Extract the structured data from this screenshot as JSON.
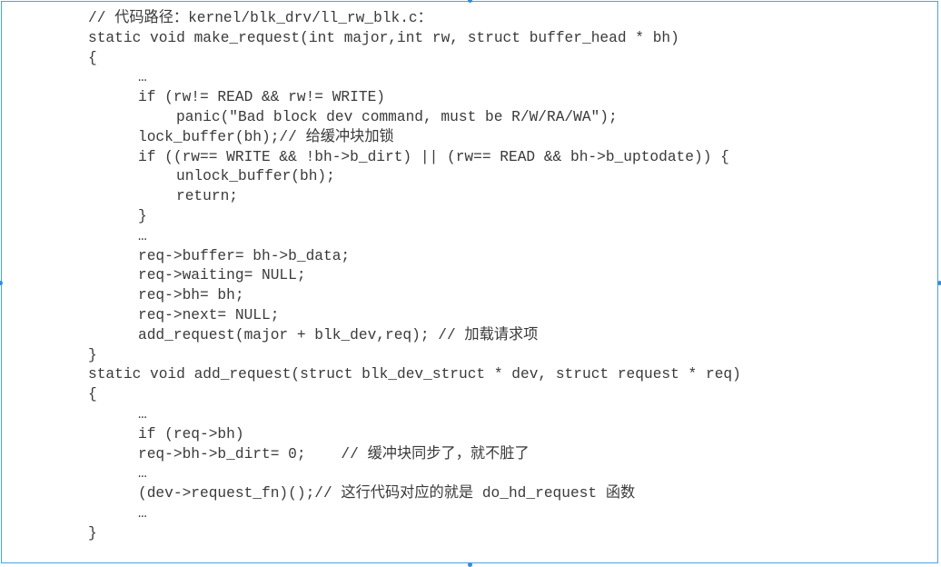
{
  "code_lines": [
    {
      "indent": 0,
      "text": "// 代码路径：kernel/blk_drv/ll_rw_blk.c："
    },
    {
      "indent": 0,
      "text": "static void make_request(int major,int rw, struct buffer_head * bh)"
    },
    {
      "indent": 0,
      "text": "{"
    },
    {
      "indent": 1,
      "text": "…"
    },
    {
      "indent": 1,
      "text": "if (rw!= READ && rw!= WRITE)"
    },
    {
      "indent": 2,
      "text": "panic(\"Bad block dev command, must be R/W/RA/WA\");"
    },
    {
      "indent": 1,
      "text": "lock_buffer(bh);// 给缓冲块加锁"
    },
    {
      "indent": 1,
      "text": "if ((rw== WRITE && !bh->b_dirt) || (rw== READ && bh->b_uptodate)) {"
    },
    {
      "indent": 2,
      "text": "unlock_buffer(bh);"
    },
    {
      "indent": 2,
      "text": "return;"
    },
    {
      "indent": 1,
      "text": "}"
    },
    {
      "indent": 1,
      "text": "…"
    },
    {
      "indent": 1,
      "text": "req->buffer= bh->b_data;"
    },
    {
      "indent": 1,
      "text": "req->waiting= NULL;"
    },
    {
      "indent": 1,
      "text": "req->bh= bh;"
    },
    {
      "indent": 1,
      "text": "req->next= NULL;"
    },
    {
      "indent": 1,
      "text": "add_request(major + blk_dev,req); // 加载请求项"
    },
    {
      "indent": 0,
      "text": "}"
    },
    {
      "indent": 0,
      "text": "static void add_request(struct blk_dev_struct * dev, struct request * req)"
    },
    {
      "indent": 0,
      "text": "{"
    },
    {
      "indent": 1,
      "text": "…"
    },
    {
      "indent": 1,
      "text": "if (req->bh)"
    },
    {
      "indent": 1,
      "text": "req->bh->b_dirt= 0;    // 缓冲块同步了，就不脏了"
    },
    {
      "indent": 1,
      "text": "…"
    },
    {
      "indent": 1,
      "text": "(dev->request_fn)();// 这行代码对应的就是 do_hd_request 函数"
    },
    {
      "indent": 1,
      "text": "…"
    },
    {
      "indent": 0,
      "text": "}"
    }
  ],
  "colors": {
    "text": "#3a3a3a",
    "frame": "#4aa3e6",
    "handle": "#2f8fe0"
  }
}
